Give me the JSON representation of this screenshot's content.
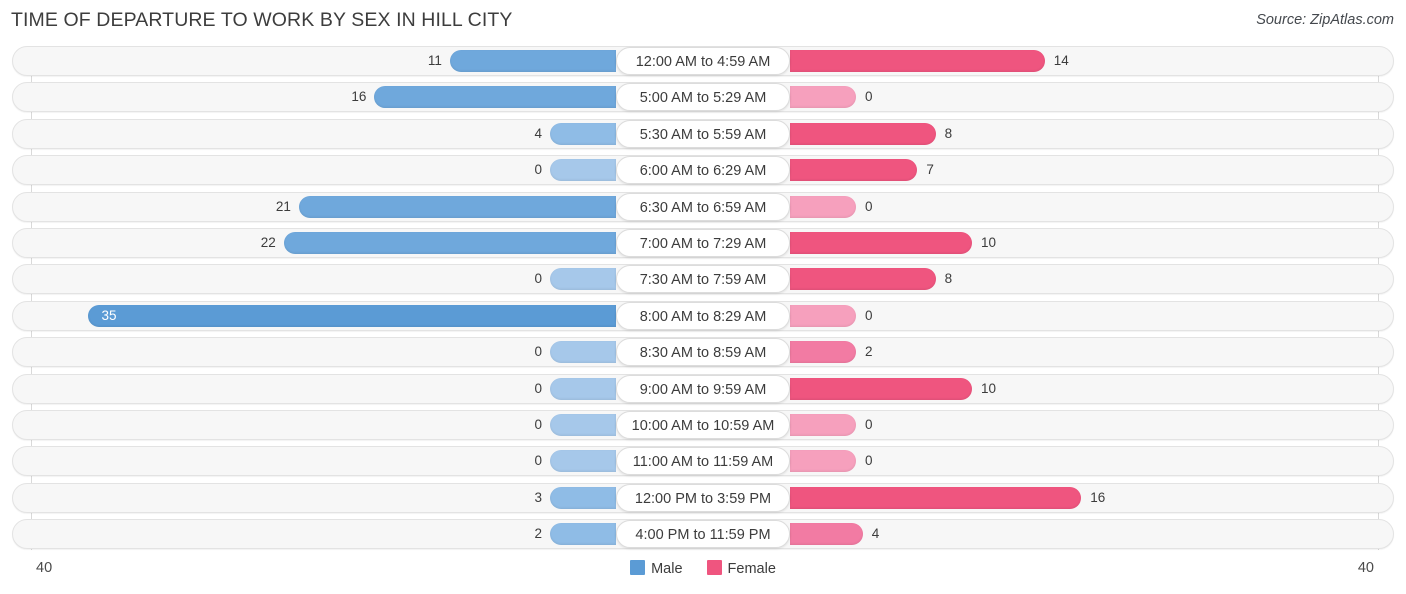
{
  "header": {
    "title": "TIME OF DEPARTURE TO WORK BY SEX IN HILL CITY",
    "source": "Source: ZipAtlas.com"
  },
  "axis": {
    "min_label": "40",
    "max_label": "40"
  },
  "legend": {
    "items": [
      {
        "label": "Male",
        "color": "#5b9bd5"
      },
      {
        "label": "Female",
        "color": "#ef557f"
      }
    ]
  },
  "colors": {
    "male": "#5b9bd5",
    "male_mid": "#6fa8dc",
    "male_light": "#a6c8ea",
    "female": "#ef557f",
    "female_mid": "#f27ba3",
    "female_light": "#f6a0bd",
    "track": "#f7f7f7",
    "grid": "#d9d9d9"
  },
  "chart_data": {
    "type": "bar",
    "orientation": "horizontal-diverging",
    "title": "TIME OF DEPARTURE TO WORK BY SEX IN HILL CITY",
    "xlabel": "",
    "ylabel": "",
    "xlim": [
      -40,
      40
    ],
    "axis_max": 40,
    "grid": true,
    "legend_position": "bottom",
    "categories": [
      "12:00 AM to 4:59 AM",
      "5:00 AM to 5:29 AM",
      "5:30 AM to 5:59 AM",
      "6:00 AM to 6:29 AM",
      "6:30 AM to 6:59 AM",
      "7:00 AM to 7:29 AM",
      "7:30 AM to 7:59 AM",
      "8:00 AM to 8:29 AM",
      "8:30 AM to 8:59 AM",
      "9:00 AM to 9:59 AM",
      "10:00 AM to 10:59 AM",
      "11:00 AM to 11:59 AM",
      "12:00 PM to 3:59 PM",
      "4:00 PM to 11:59 PM"
    ],
    "series": [
      {
        "name": "Male",
        "values": [
          11,
          16,
          4,
          0,
          21,
          22,
          0,
          35,
          0,
          0,
          0,
          0,
          3,
          2
        ]
      },
      {
        "name": "Female",
        "values": [
          14,
          0,
          8,
          7,
          0,
          10,
          8,
          0,
          2,
          10,
          0,
          0,
          16,
          4
        ]
      }
    ]
  },
  "rows": [
    {
      "label": "12:00 AM to 4:59 AM",
      "male": "11",
      "female": "14"
    },
    {
      "label": "5:00 AM to 5:29 AM",
      "male": "16",
      "female": "0"
    },
    {
      "label": "5:30 AM to 5:59 AM",
      "male": "4",
      "female": "8"
    },
    {
      "label": "6:00 AM to 6:29 AM",
      "male": "0",
      "female": "7"
    },
    {
      "label": "6:30 AM to 6:59 AM",
      "male": "21",
      "female": "0"
    },
    {
      "label": "7:00 AM to 7:29 AM",
      "male": "22",
      "female": "10"
    },
    {
      "label": "7:30 AM to 7:59 AM",
      "male": "0",
      "female": "8"
    },
    {
      "label": "8:00 AM to 8:29 AM",
      "male": "35",
      "female": "0"
    },
    {
      "label": "8:30 AM to 8:59 AM",
      "male": "0",
      "female": "2"
    },
    {
      "label": "9:00 AM to 9:59 AM",
      "male": "0",
      "female": "10"
    },
    {
      "label": "10:00 AM to 10:59 AM",
      "male": "0",
      "female": "0"
    },
    {
      "label": "11:00 AM to 11:59 AM",
      "male": "0",
      "female": "0"
    },
    {
      "label": "12:00 PM to 3:59 PM",
      "male": "3",
      "female": "16"
    },
    {
      "label": "4:00 PM to 11:59 PM",
      "male": "2",
      "female": "4"
    }
  ]
}
